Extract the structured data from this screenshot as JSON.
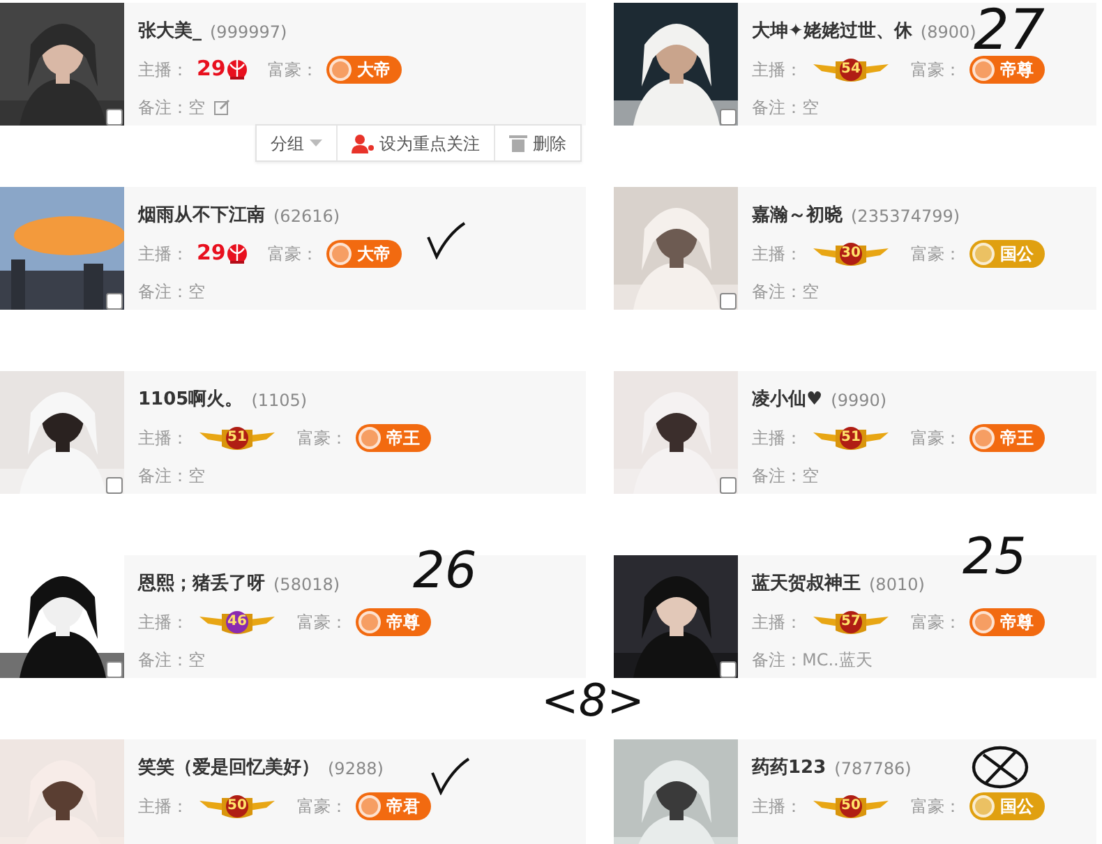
{
  "cards": [
    {
      "name": "张大美_",
      "id": "(999997)",
      "anchor_label": "主播：",
      "anchor": {
        "kind": "crown",
        "level": "29"
      },
      "rich_label": "富豪：",
      "rich": {
        "text": "大帝",
        "color": "#f26a10"
      },
      "remark": "备注：空",
      "editable": true,
      "checked": false,
      "actions": [
        {
          "label": "分组",
          "kind": "dropdown"
        },
        {
          "label": "设为重点关注",
          "kind": "follow"
        },
        {
          "label": "删除",
          "kind": "delete"
        }
      ]
    },
    {
      "name": "大坤✦姥姥过世、休",
      "id": "(8900)",
      "anchor_label": "主播：",
      "anchor": {
        "kind": "wings",
        "level": "54",
        "color": "#b01e14"
      },
      "rich_label": "富豪：",
      "rich": {
        "text": "帝尊",
        "color": "#f26a10"
      },
      "remark": "备注：空",
      "checked": false
    },
    {
      "name": "烟雨从不下江南",
      "id": "(62616)",
      "anchor_label": "主播：",
      "anchor": {
        "kind": "crown",
        "level": "29"
      },
      "rich_label": "富豪：",
      "rich": {
        "text": "大帝",
        "color": "#f26a10"
      },
      "remark": "备注：空",
      "checked": false
    },
    {
      "name": "嘉瀚～初晓",
      "id": "(235374799)",
      "anchor_label": "主播：",
      "anchor": {
        "kind": "wings",
        "level": "30",
        "color": "#b01e14"
      },
      "rich_label": "富豪：",
      "rich": {
        "text": "国公",
        "color": "#e0a010"
      },
      "remark": "备注：空",
      "checked": false
    },
    {
      "name": "1105啊火。",
      "id": "(1105)",
      "anchor_label": "主播：",
      "anchor": {
        "kind": "wings",
        "level": "51",
        "color": "#b01e14"
      },
      "rich_label": "富豪：",
      "rich": {
        "text": "帝王",
        "color": "#f26a10"
      },
      "remark": "备注：空",
      "checked": false
    },
    {
      "name": "凌小仙♥",
      "id": "(9990)",
      "anchor_label": "主播：",
      "anchor": {
        "kind": "wings",
        "level": "51",
        "color": "#b01e14"
      },
      "rich_label": "富豪：",
      "rich": {
        "text": "帝王",
        "color": "#f26a10"
      },
      "remark": "备注：空",
      "checked": false
    },
    {
      "name": "恩熙；猪丢了呀",
      "id": "(58018)",
      "anchor_label": "主播：",
      "anchor": {
        "kind": "wings",
        "level": "46",
        "color": "#8a2bb0"
      },
      "rich_label": "富豪：",
      "rich": {
        "text": "帝尊",
        "color": "#f26a10"
      },
      "remark": "备注：空",
      "checked": false
    },
    {
      "name": "蓝天贺叔神王",
      "id": "(8010)",
      "anchor_label": "主播：",
      "anchor": {
        "kind": "wings",
        "level": "57",
        "color": "#b01e14"
      },
      "rich_label": "富豪：",
      "rich": {
        "text": "帝尊",
        "color": "#f26a10"
      },
      "remark": "备注：MC..蓝天",
      "checked": false
    },
    {
      "name": "笑笑（爱是回忆美好）",
      "id": "(9288)",
      "anchor_label": "主播：",
      "anchor": {
        "kind": "wings",
        "level": "50",
        "color": "#b01e14"
      },
      "rich_label": "富豪：",
      "rich": {
        "text": "帝君",
        "color": "#f26a10"
      }
    },
    {
      "name": "药药123",
      "id": "(787786)",
      "anchor_label": "主播：",
      "anchor": {
        "kind": "wings",
        "level": "50",
        "color": "#b01e14"
      },
      "rich_label": "富豪：",
      "rich": {
        "text": "国公",
        "color": "#e0a010"
      }
    }
  ],
  "annotations": [
    {
      "kind": "text",
      "text": "27"
    },
    {
      "kind": "check"
    },
    {
      "kind": "text",
      "text": "26"
    },
    {
      "kind": "text",
      "text": "25"
    },
    {
      "kind": "text",
      "text": "<8>"
    },
    {
      "kind": "check"
    },
    {
      "kind": "crossed-box"
    }
  ]
}
